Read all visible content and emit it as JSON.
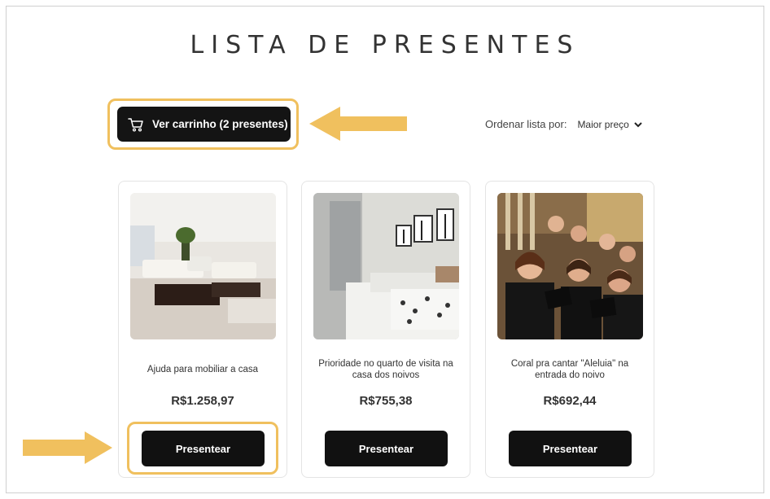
{
  "header": {
    "title": "LISTA DE PRESENTES"
  },
  "cart": {
    "label": "Ver carrinho (2 presentes)",
    "icon": "cart-icon"
  },
  "sort": {
    "label": "Ordenar lista por:",
    "selected": "Maior preço"
  },
  "products": [
    {
      "title": "Ajuda para mobiliar a casa",
      "price": "R$1.258,97",
      "button": "Presentear"
    },
    {
      "title": "Prioridade no quarto de visita na casa dos noivos",
      "price": "R$755,38",
      "button": "Presentear"
    },
    {
      "title": "Coral pra cantar \"Aleluia\" na entrada do noivo",
      "price": "R$692,44",
      "button": "Presentear"
    }
  ],
  "colors": {
    "accent_highlight": "#f0c05e",
    "button_bg": "#111111",
    "text": "#333333"
  }
}
